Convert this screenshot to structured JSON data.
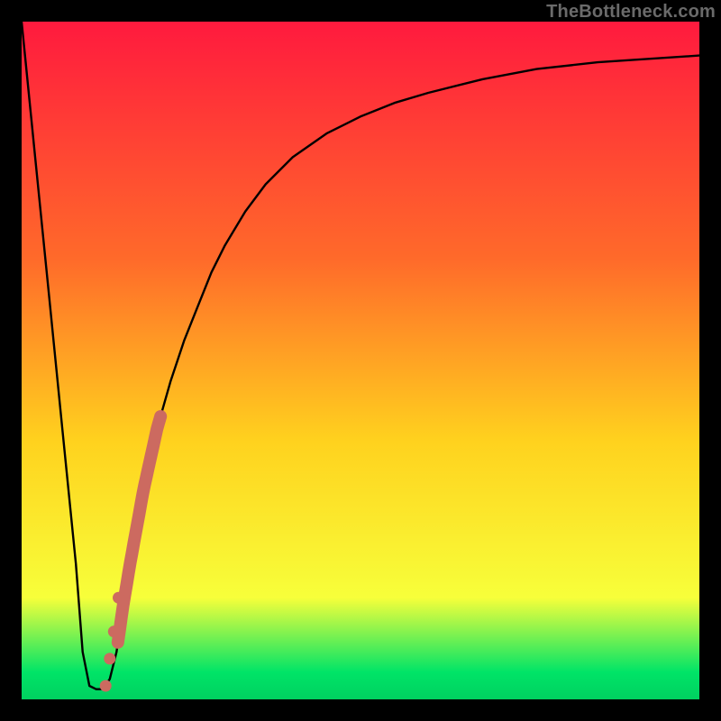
{
  "watermark": "TheBottleneck.com",
  "colors": {
    "gradient_top": "#ff1a3e",
    "gradient_mid_upper": "#ff6a2a",
    "gradient_mid": "#ffd21e",
    "gradient_mid_lower": "#f7ff3a",
    "gradient_green": "#00e467",
    "gradient_bottom": "#00d060",
    "curve": "#000000",
    "dots": "#cc6a60",
    "frame": "#000000"
  },
  "chart_data": {
    "type": "line",
    "title": "",
    "xlabel": "",
    "ylabel": "",
    "xlim": [
      0,
      100
    ],
    "ylim": [
      0,
      100
    ],
    "series": [
      {
        "name": "bottleneck-curve",
        "x": [
          0,
          2,
          4,
          6,
          8,
          9,
          10,
          11,
          12,
          13,
          14,
          15,
          16,
          18,
          20,
          22,
          24,
          26,
          28,
          30,
          33,
          36,
          40,
          45,
          50,
          55,
          60,
          68,
          76,
          85,
          100
        ],
        "y": [
          100,
          80,
          60,
          40,
          20,
          7,
          2,
          1.5,
          1.5,
          3,
          7,
          14,
          20,
          31,
          40,
          47,
          53,
          58,
          63,
          67,
          72,
          76,
          80,
          83.5,
          86,
          88,
          89.5,
          91.5,
          93,
          94,
          95
        ]
      }
    ],
    "segment": {
      "name": "highlighted-range",
      "x_start": 14.2,
      "x_end": 20.5,
      "end_dots_x": [
        13.0,
        13.6,
        14.3,
        12.4
      ],
      "end_dots_y": [
        6,
        10,
        15,
        2
      ]
    }
  }
}
